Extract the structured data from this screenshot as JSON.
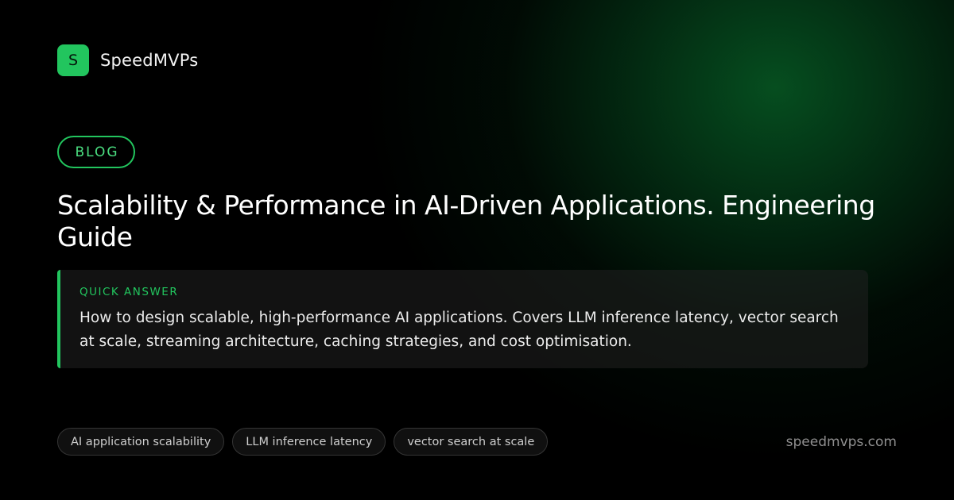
{
  "brand": {
    "logo_letter": "S",
    "name": "SpeedMVPs"
  },
  "badge": {
    "label": "BLOG"
  },
  "article": {
    "title": "Scalability & Performance in AI-Driven Applications. Engineering Guide"
  },
  "quick_answer": {
    "label": "QUICK ANSWER",
    "text": "How to design scalable, high-performance AI applications. Covers LLM inference latency, vector search at scale, streaming architecture, caching strategies, and cost optimisation."
  },
  "tags": [
    "AI application scalability",
    "LLM inference latency",
    "vector search at scale"
  ],
  "footer": {
    "site_url": "speedmvps.com"
  },
  "colors": {
    "accent": "#22c55e",
    "background": "#000000",
    "glow": "#06521f"
  }
}
